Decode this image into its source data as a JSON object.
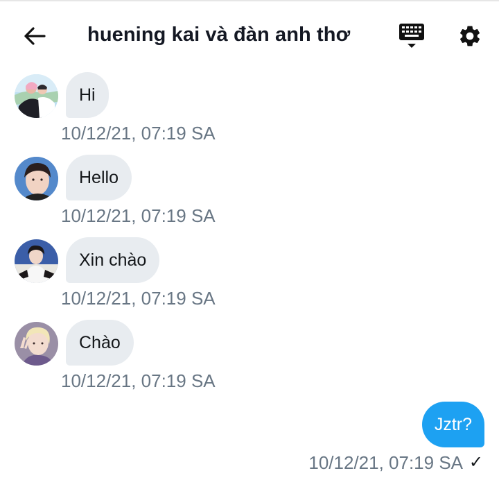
{
  "header": {
    "title": "huening kai và đàn anh thơ"
  },
  "messages": [
    {
      "text": "Hi",
      "time": "10/12/21, 07:19 SA"
    },
    {
      "text": "Hello",
      "time": "10/12/21, 07:19 SA"
    },
    {
      "text": "Xin chào",
      "time": "10/12/21, 07:19 SA"
    },
    {
      "text": "Chào",
      "time": "10/12/21, 07:19 SA"
    }
  ],
  "outgoing": {
    "text": "Jztr?",
    "time": "10/12/21, 07:19 SA",
    "status_mark": "✓"
  },
  "colors": {
    "accent": "#1da1f2",
    "incoming_bubble": "#e8ecf0",
    "timestamp": "#687684"
  }
}
